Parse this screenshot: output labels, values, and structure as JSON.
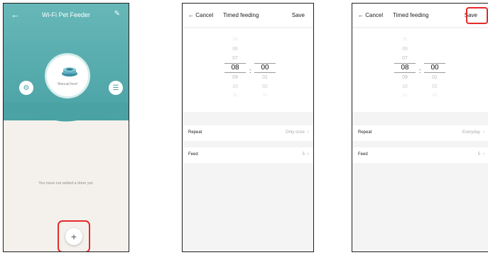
{
  "home": {
    "title": "Wi-Fi Pet Feeder",
    "manual_feed_label": "Manual feed",
    "empty_message": "You have not added a timer yet.",
    "add_label": "+"
  },
  "timed_before": {
    "cancel_label": "← Cancel",
    "title": "Timed feeding",
    "save_label": "Save",
    "hours": [
      "05",
      "06",
      "07",
      "08",
      "09",
      "10",
      "11"
    ],
    "minutes": [
      "00",
      "01",
      "02",
      "03"
    ],
    "separator": ":",
    "repeat_label": "Repeat",
    "repeat_value": "Only once",
    "feed_label": "Feed",
    "feed_value": "5"
  },
  "timed_after": {
    "cancel_label": "← Cancel",
    "title": "Timed feeding",
    "save_label": "Save",
    "hours": [
      "05",
      "06",
      "07",
      "08",
      "09",
      "10",
      "11"
    ],
    "minutes": [
      "00",
      "01",
      "02",
      "03"
    ],
    "separator": ":",
    "repeat_label": "Repeat",
    "repeat_value": "Everyday",
    "feed_label": "Feed",
    "feed_value": "5"
  },
  "colors": {
    "teal": "#4aa2a4",
    "highlight": "#e42a2a"
  },
  "icons": [
    "back-arrow-icon",
    "edit-pencil-icon",
    "gear-icon",
    "list-icon",
    "feeder-bowl-icon",
    "plus-icon",
    "chevron-right-icon"
  ]
}
